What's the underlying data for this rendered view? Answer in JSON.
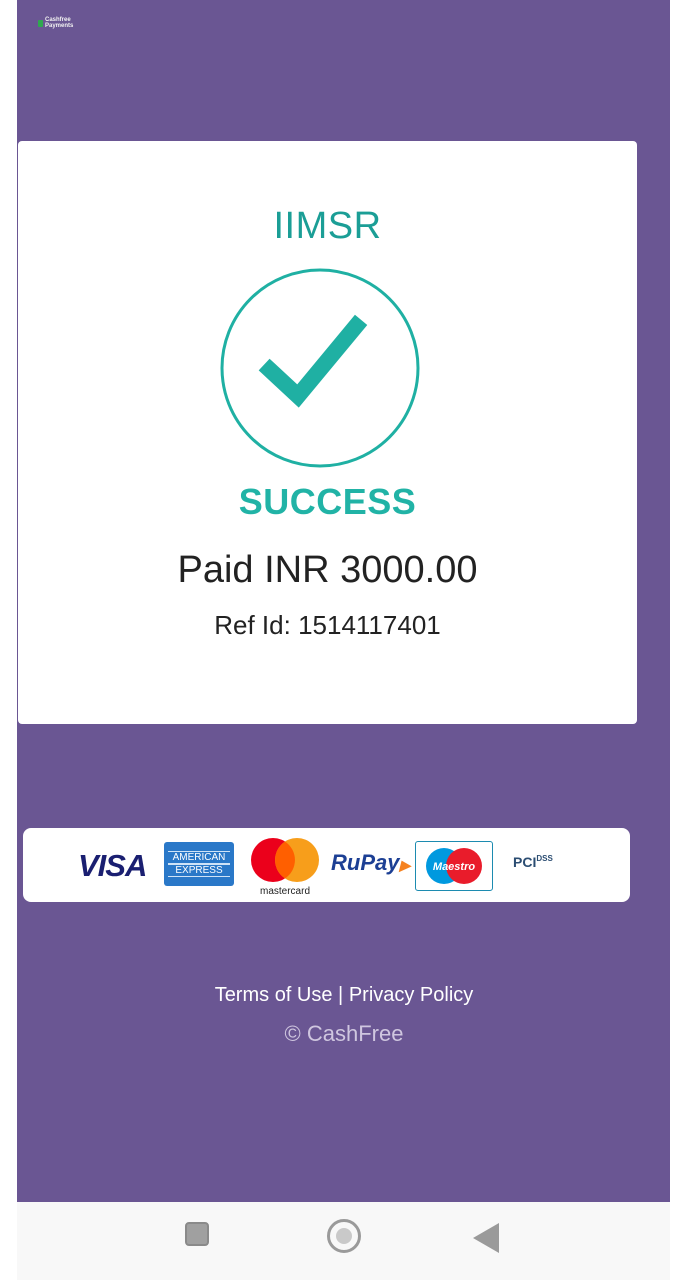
{
  "header": {
    "logo_line1": "Cashfree",
    "logo_line2": "Payments"
  },
  "card": {
    "merchant": "IIMSR",
    "status": "SUCCESS",
    "amount": "Paid INR 3000.00",
    "ref": "Ref Id: 1514117401"
  },
  "payment_methods": {
    "visa": "VISA",
    "amex_line1": "AMERICAN",
    "amex_line2": "EXPRESS",
    "mastercard": "mastercard",
    "rupay": "RuPay",
    "maestro": "Maestro",
    "pci": "PCI",
    "pci_dss": "DSS"
  },
  "footer": {
    "terms": "Terms of Use",
    "separator": " | ",
    "privacy": "Privacy Policy",
    "copyright": "© CashFree"
  },
  "colors": {
    "background": "#6a5693",
    "accent": "#21b3a6"
  },
  "navbar": {
    "icons": [
      "recents-icon",
      "home-icon",
      "back-icon"
    ]
  }
}
